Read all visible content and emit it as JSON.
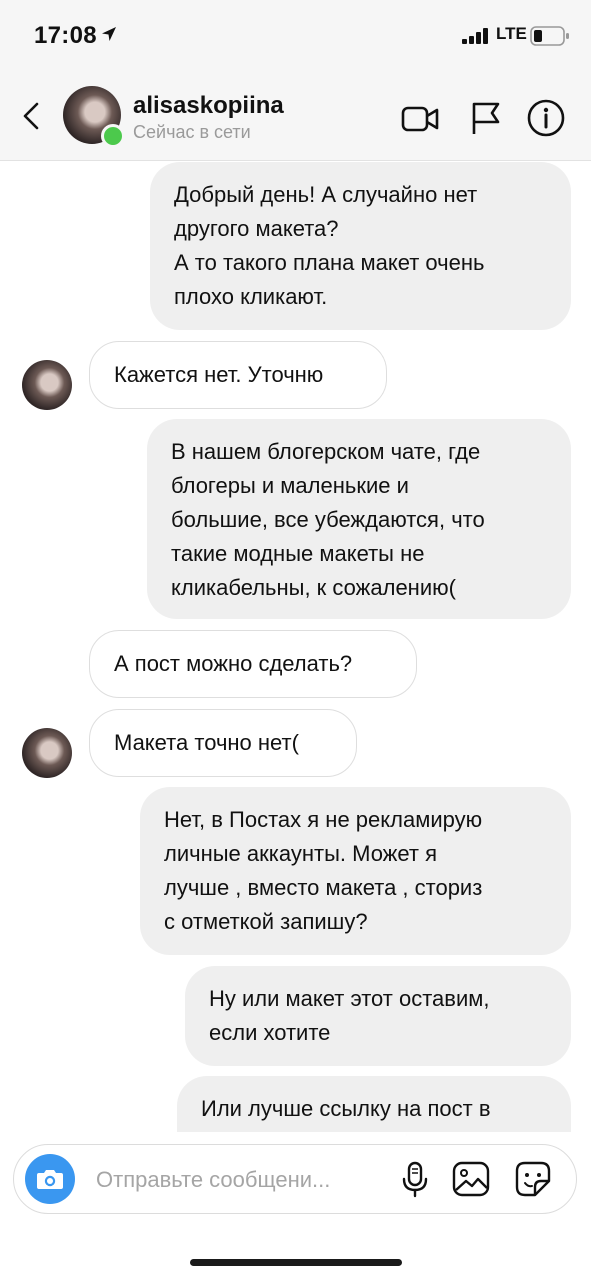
{
  "status_bar": {
    "time": "17:08",
    "network": "LTE"
  },
  "header": {
    "username": "alisaskopiina",
    "presence": "Сейчас в сети",
    "status_color": "#4cc94c",
    "icons": [
      "chevron-left-icon",
      "video-camera-icon",
      "flag-icon",
      "info-icon"
    ]
  },
  "messages": [
    {
      "direction": "outgoing",
      "lines": [
        "Добрый день! А случайно нет",
        "другого макета?"
      ],
      "lines2": [
        "А то такого плана макет очень",
        "плохо кликают."
      ]
    },
    {
      "direction": "incoming",
      "text": "Кажется нет. Уточню",
      "avatar": true
    },
    {
      "direction": "outgoing",
      "lines": [
        "В нашем блогерском чате, где",
        "блогеры и маленькие и",
        "большие, все убеждаются, что",
        "такие модные макеты не",
        "кликабельны, к сожалению("
      ]
    },
    {
      "direction": "incoming",
      "text": "А пост можно сделать?",
      "avatar": false
    },
    {
      "direction": "incoming",
      "text": "Макета точно нет(",
      "avatar": true
    },
    {
      "direction": "outgoing",
      "lines": [
        "Нет, в Постах я не рекламирую",
        "личные аккаунты. Может я",
        "лучше , вместо макета , сториз",
        "с отметкой запишу?"
      ]
    },
    {
      "direction": "outgoing",
      "lines": [
        "Ну или макет этот оставим,",
        "если хотите"
      ]
    },
    {
      "direction": "outgoing",
      "lines": [
        "Или лучше ссылку на пост в"
      ]
    }
  ],
  "composer": {
    "placeholder": "Отправьте сообщени...",
    "accent_color": "#3a97f0",
    "icons": [
      "camera-icon",
      "microphone-icon",
      "gallery-icon",
      "sticker-icon"
    ]
  }
}
